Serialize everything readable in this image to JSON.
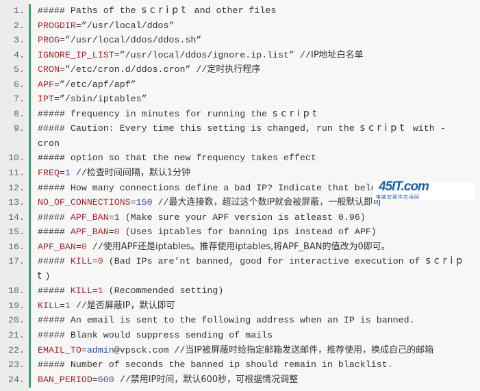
{
  "lines": [
    {
      "n": "1.",
      "tokens": [
        [
          "c",
          "##### Paths of the "
        ],
        [
          "w",
          "script"
        ],
        [
          "c",
          " and other files"
        ]
      ]
    },
    {
      "n": "2.",
      "tokens": [
        [
          "v",
          "PROGDIR"
        ],
        [
          "c",
          "=”/usr/local/ddos”"
        ]
      ]
    },
    {
      "n": "3.",
      "tokens": [
        [
          "v",
          "PROG"
        ],
        [
          "c",
          "=”/usr/local/ddos/ddos.sh”"
        ]
      ]
    },
    {
      "n": "4.",
      "tokens": [
        [
          "v",
          "IGNORE_IP_LIST"
        ],
        [
          "c",
          "=”/usr/local/ddos/ignore.ip.list” //"
        ],
        [
          "z",
          "IP地址白名单"
        ]
      ]
    },
    {
      "n": "5.",
      "tokens": [
        [
          "v",
          "CRON"
        ],
        [
          "c",
          "=”/etc/cron.d/ddos.cron” //"
        ],
        [
          "z",
          "定时执行程序"
        ]
      ]
    },
    {
      "n": "6.",
      "tokens": [
        [
          "v",
          "APF"
        ],
        [
          "c",
          "=”/etc/apf/apf”"
        ]
      ]
    },
    {
      "n": "7.",
      "tokens": [
        [
          "v",
          "IPT"
        ],
        [
          "c",
          "=”/sbin/iptables”"
        ]
      ]
    },
    {
      "n": "8.",
      "tokens": [
        [
          "c",
          "##### frequency in minutes for running the "
        ],
        [
          "w",
          "script"
        ]
      ]
    },
    {
      "n": "9.",
      "tokens": [
        [
          "c",
          "##### Caution: Every time this setting is changed, run the "
        ],
        [
          "w",
          "script"
        ],
        [
          "c",
          " with -"
        ]
      ],
      "cont": [
        [
          "c",
          "cron"
        ]
      ]
    },
    {
      "n": "10.",
      "tokens": [
        [
          "c",
          "##### option so that the new frequency takes effect"
        ]
      ]
    },
    {
      "n": "11.",
      "tokens": [
        [
          "v",
          "FREQ"
        ],
        [
          "c",
          "="
        ],
        [
          "n",
          "1"
        ],
        [
          "c",
          " //"
        ],
        [
          "z",
          "检查时间间隔，默认1分钟"
        ]
      ]
    },
    {
      "n": "12.",
      "tokens": [
        [
          "c",
          "##### How many connections define a bad IP? Indicate that below."
        ]
      ]
    },
    {
      "n": "13.",
      "tokens": [
        [
          "v",
          "NO_OF_CONNECTIONS"
        ],
        [
          "c",
          "="
        ],
        [
          "n",
          "150"
        ],
        [
          "c",
          " //"
        ],
        [
          "z",
          "最大连接数，超过这个数IP就会被屏蔽，一般默认即可"
        ]
      ]
    },
    {
      "n": "14.",
      "tokens": [
        [
          "c",
          "##### "
        ],
        [
          "v",
          "APF_BAN"
        ],
        [
          "c",
          "="
        ],
        [
          "nr",
          "1"
        ],
        [
          "c",
          " (Make sure your APF version is atleast 0.96)"
        ]
      ]
    },
    {
      "n": "15.",
      "tokens": [
        [
          "c",
          "##### "
        ],
        [
          "v",
          "APF_BAN"
        ],
        [
          "c",
          "="
        ],
        [
          "nr",
          "0"
        ],
        [
          "c",
          " (Uses iptables for banning ips instead of APF)"
        ]
      ]
    },
    {
      "n": "16.",
      "tokens": [
        [
          "v",
          "APF_BAN"
        ],
        [
          "c",
          "="
        ],
        [
          "nr",
          "0"
        ],
        [
          "c",
          " //"
        ],
        [
          "z",
          "使用APF还是iptables。推荐使用iptables,将APF_BAN的值改为0即可。"
        ]
      ]
    },
    {
      "n": "17.",
      "tokens": [
        [
          "c",
          "##### "
        ],
        [
          "v",
          "KILL"
        ],
        [
          "c",
          "="
        ],
        [
          "nr",
          "0"
        ],
        [
          "c",
          " (Bad IPs are’nt banned, good for interactive execution of "
        ],
        [
          "w",
          "scrip"
        ]
      ],
      "cont": [
        [
          "w",
          "t"
        ],
        [
          "c",
          ")"
        ]
      ]
    },
    {
      "n": "18.",
      "tokens": [
        [
          "c",
          "##### "
        ],
        [
          "v",
          "KILL"
        ],
        [
          "c",
          "="
        ],
        [
          "nr",
          "1"
        ],
        [
          "c",
          " (Recommended setting)"
        ]
      ]
    },
    {
      "n": "19.",
      "tokens": [
        [
          "v",
          "KILL"
        ],
        [
          "c",
          "="
        ],
        [
          "nr",
          "1"
        ],
        [
          "c",
          " //"
        ],
        [
          "z",
          "是否屏蔽IP，默认即可"
        ]
      ]
    },
    {
      "n": "20.",
      "tokens": [
        [
          "c",
          "##### An email is sent to the following address when an IP is banned."
        ]
      ]
    },
    {
      "n": "21.",
      "tokens": [
        [
          "c",
          "##### Blank would suppress sending of mails"
        ]
      ]
    },
    {
      "n": "22.",
      "tokens": [
        [
          "v",
          "EMAIL_TO"
        ],
        [
          "c",
          "="
        ],
        [
          "e",
          "admin"
        ],
        [
          "c",
          "@vpsck.com //"
        ],
        [
          "z",
          "当IP被屏蔽时给指定邮箱发送邮件，推荐使用，换成自己的邮箱"
        ]
      ]
    },
    {
      "n": "23.",
      "tokens": [
        [
          "c",
          "##### Number of seconds the banned ip should remain in blacklist."
        ]
      ]
    },
    {
      "n": "24.",
      "tokens": [
        [
          "v",
          "BAN_PERIOD"
        ],
        [
          "c",
          "="
        ],
        [
          "n",
          "600"
        ],
        [
          "c",
          " //"
        ],
        [
          "z",
          "禁用IP时间，默认600秒，可根据情况调整"
        ]
      ]
    }
  ],
  "watermark": {
    "mark": "45IT.com",
    "sub": "电脑软硬件应用网"
  },
  "colors": {
    "variable": "#a6242b",
    "number": "#4b45a8",
    "accent_bar": "#3aa564",
    "gutter": "#ececec",
    "background": "#f7f7f7"
  }
}
